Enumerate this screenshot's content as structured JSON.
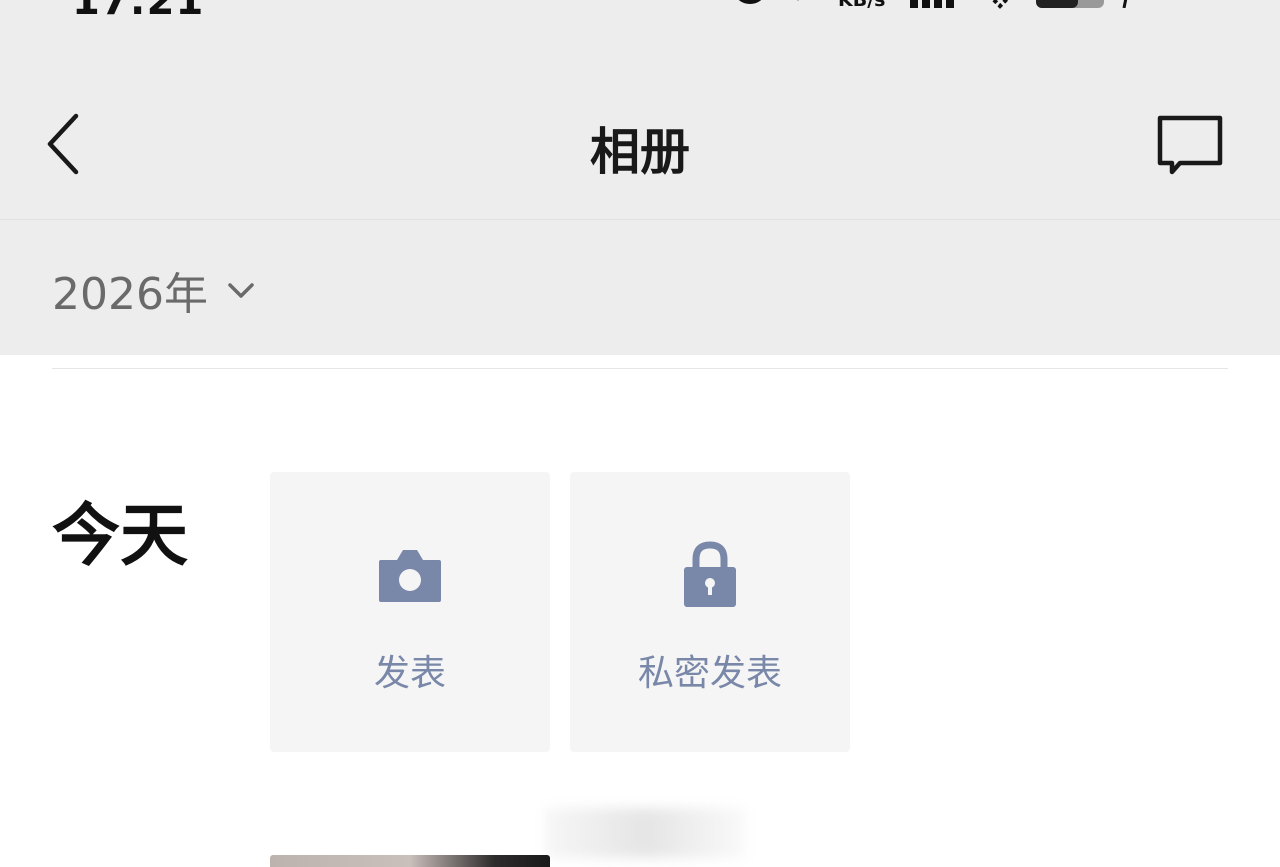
{
  "status_bar": {
    "time": "17:21",
    "net_speed_unit": "KB/s"
  },
  "header": {
    "title": "相册",
    "back_icon": "chevron-left-icon",
    "message_icon": "chat-bubble-icon"
  },
  "year_filter": {
    "label": "2026年",
    "icon": "chevron-down-icon"
  },
  "timeline": {
    "day_label": "今天",
    "actions": [
      {
        "label": "发表",
        "icon": "camera-icon"
      },
      {
        "label": "私密发表",
        "icon": "lock-icon"
      }
    ]
  },
  "colors": {
    "header_bg": "#ededed",
    "action_tile_bg": "#f5f5f6",
    "action_accent": "#7987a8",
    "title_text": "#191919"
  }
}
